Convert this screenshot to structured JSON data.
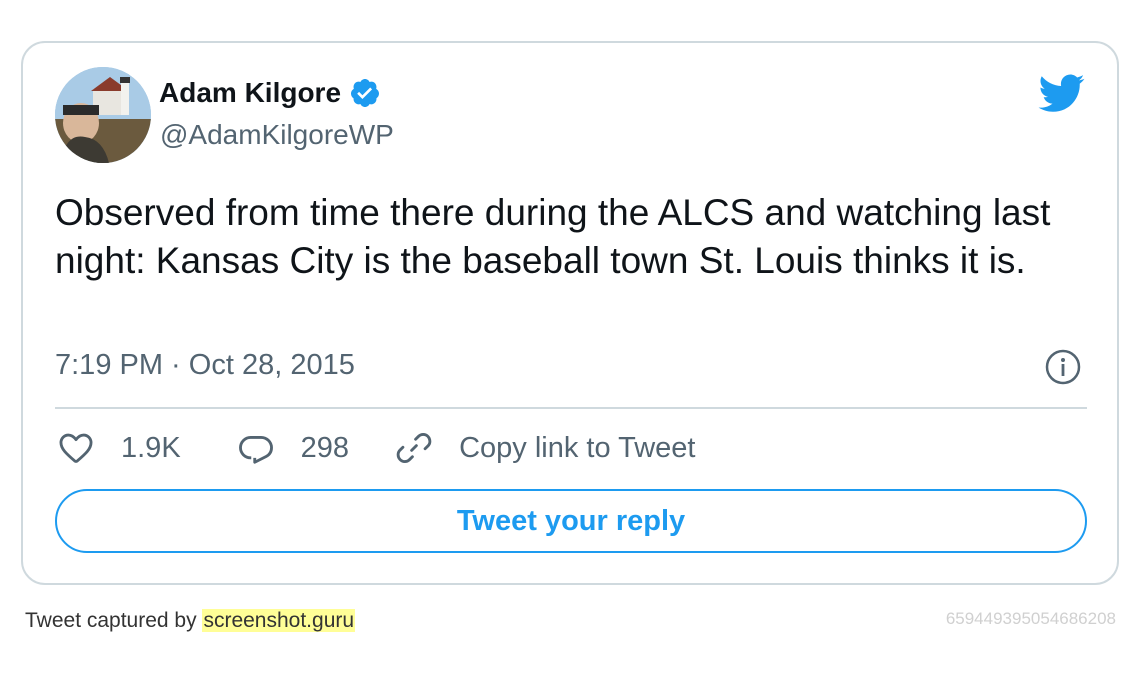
{
  "author": {
    "name": "Adam Kilgore",
    "handle": "@AdamKilgoreWP",
    "verified": true
  },
  "tweet": {
    "text": "Observed from time there during the ALCS and watching last night: Kansas City is the baseball town St. Louis thinks it is.",
    "timestamp": "7:19 PM · Oct 28, 2015"
  },
  "actions": {
    "likes": "1.9K",
    "replies": "298",
    "copy_link_label": "Copy link to Tweet"
  },
  "reply_button_label": "Tweet your reply",
  "footer": {
    "prefix": "Tweet captured by",
    "site": "screenshot.guru",
    "tweet_id": "659449395054686208"
  },
  "colors": {
    "accent": "#1d9bf0",
    "text": "#0f1419",
    "muted": "#536471",
    "border": "#cfd9de"
  },
  "icons": [
    "verified-badge-icon",
    "twitter-bird-icon",
    "info-icon",
    "heart-icon",
    "reply-bubble-icon",
    "link-icon"
  ]
}
